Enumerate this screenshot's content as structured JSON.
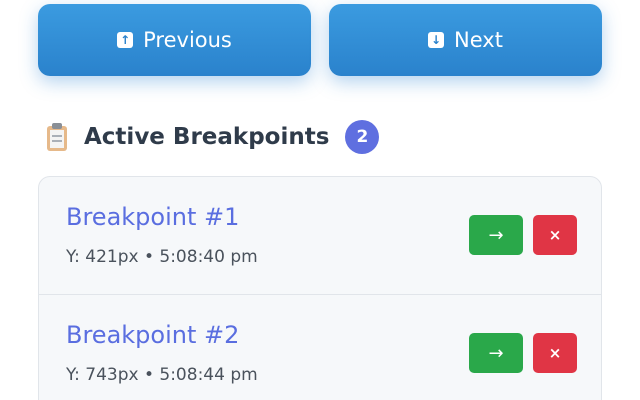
{
  "navigation": {
    "previous": {
      "label": "Previous",
      "icon": "up-arrow-icon",
      "glyph": "↑"
    },
    "next": {
      "label": "Next",
      "icon": "down-arrow-icon",
      "glyph": "↓"
    }
  },
  "section": {
    "icon": "clipboard-icon",
    "title": "Active Breakpoints",
    "count": "2"
  },
  "breakpoints": [
    {
      "title": "Breakpoint #1",
      "meta": "Y: 421px • 5:08:40 pm",
      "go_glyph": "→",
      "delete_glyph": "×"
    },
    {
      "title": "Breakpoint #2",
      "meta": "Y: 743px • 5:08:44 pm",
      "go_glyph": "→",
      "delete_glyph": "×"
    }
  ],
  "colors": {
    "nav_button": "#2a82cc",
    "title_accent": "#5a6ee0",
    "badge": "#5f6fe0",
    "go_button": "#2aa84a",
    "delete_button": "#e03545"
  }
}
